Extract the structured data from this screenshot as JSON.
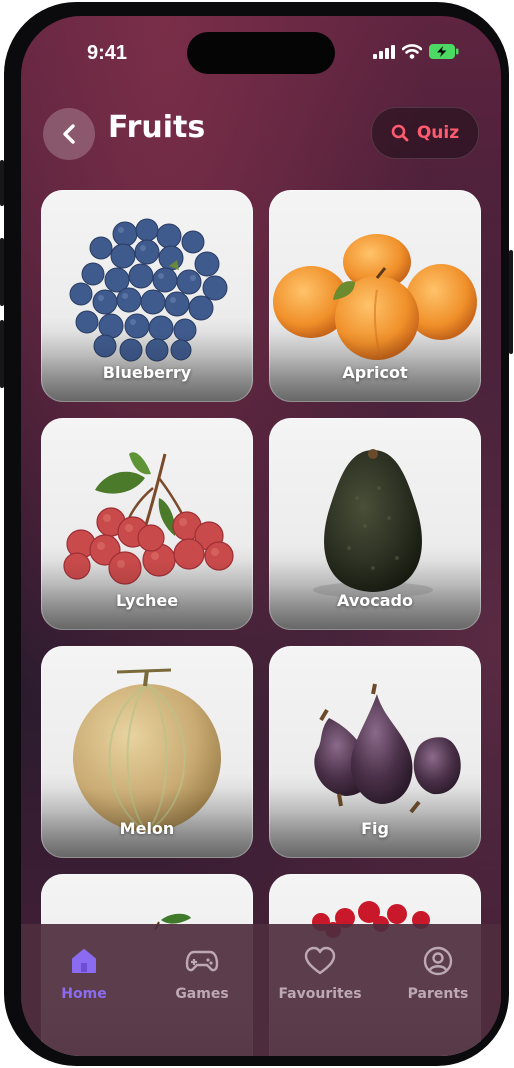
{
  "status_bar": {
    "time": "9:41"
  },
  "header": {
    "title": "Fruits",
    "quiz_label": "Quiz"
  },
  "fruits": [
    {
      "name": "Blueberry"
    },
    {
      "name": "Apricot"
    },
    {
      "name": "Lychee"
    },
    {
      "name": "Avocado"
    },
    {
      "name": "Melon"
    },
    {
      "name": "Fig"
    }
  ],
  "tabs": [
    {
      "label": "Home",
      "icon": "home-icon",
      "active": true
    },
    {
      "label": "Games",
      "icon": "gamepad-icon",
      "active": false
    },
    {
      "label": "Favourites",
      "icon": "heart-icon",
      "active": false
    },
    {
      "label": "Parents",
      "icon": "user-circle-icon",
      "active": false
    }
  ],
  "colors": {
    "accent": "#8b6cf0",
    "quiz": "#ff5b6e",
    "battery": "#4cd964"
  }
}
